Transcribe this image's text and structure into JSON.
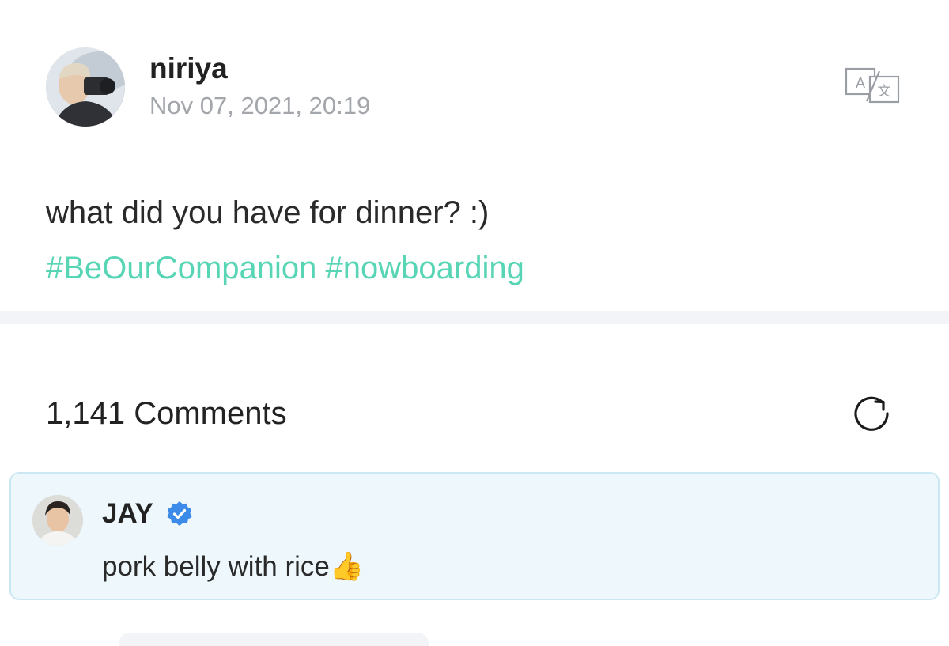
{
  "post": {
    "author": "niriya",
    "date": "Nov 07, 2021, 20:19",
    "text": "what did you have for dinner? :)",
    "hashtags": [
      "#BeOurCompanion",
      "#nowboarding"
    ],
    "translate_icon": "translate-icon"
  },
  "comments": {
    "count_label": "1,141 Comments",
    "refresh_icon": "refresh-icon",
    "highlighted": {
      "author": "JAY",
      "verified_icon": "verified-badge-icon",
      "text": "pork belly with rice",
      "emoji": "👍"
    }
  },
  "colors": {
    "hashtag": "#57d5b5",
    "date": "#a3a6ab",
    "card_bg": "#eef8fc",
    "card_border": "#cbe7f1",
    "verified": "#3d8be8"
  }
}
